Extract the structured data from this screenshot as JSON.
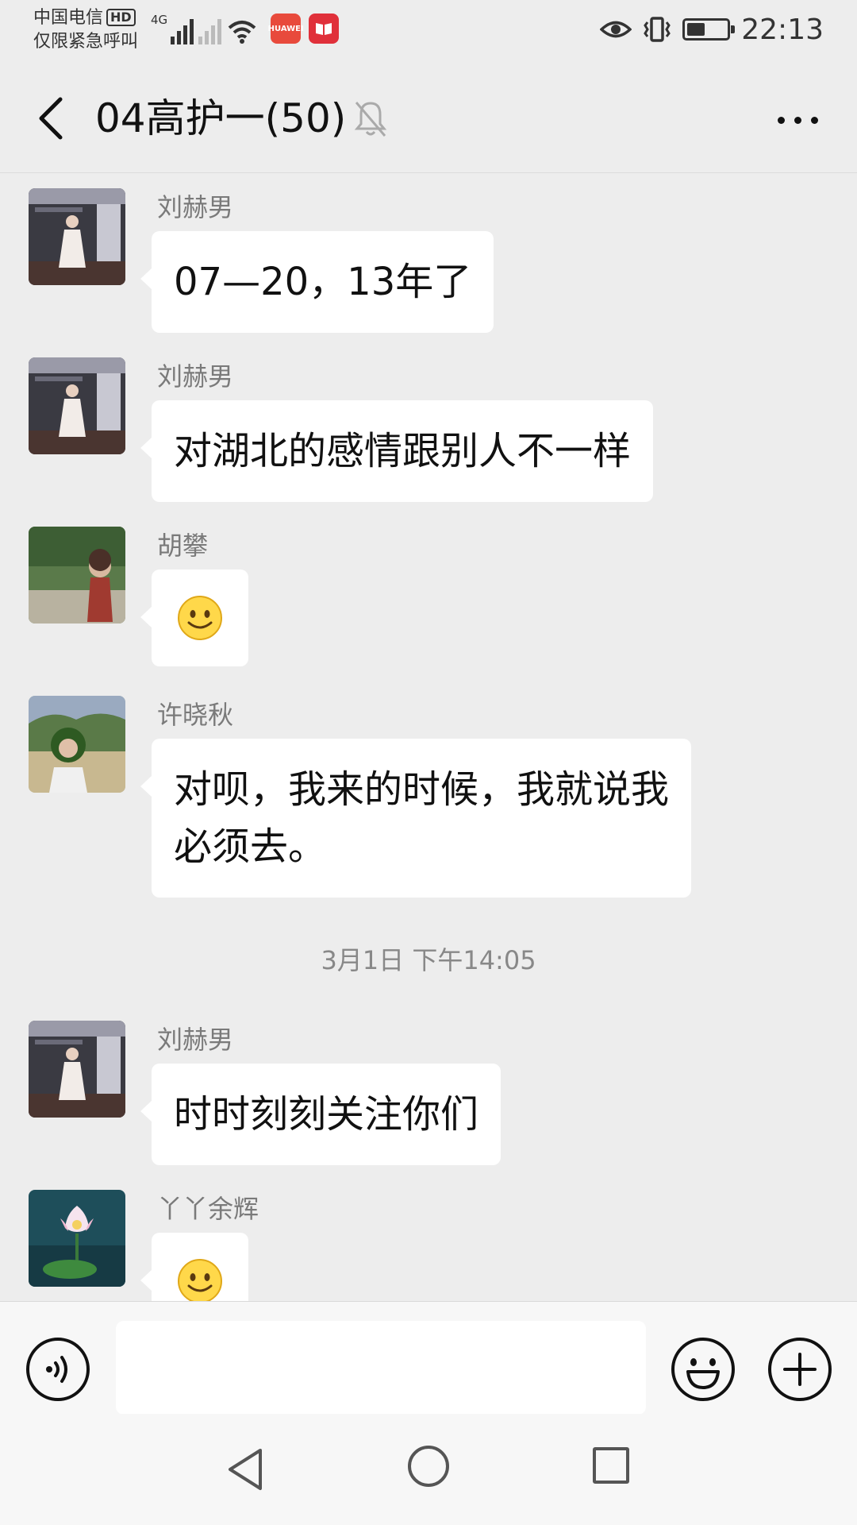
{
  "status_bar": {
    "carrier_line1": "中国电信",
    "hd_badge": "HD",
    "carrier_line2": "仅限紧急呼叫",
    "network": "4G",
    "app_badge1": "HUAWEI",
    "time": "22:13",
    "battery_level": 0.45
  },
  "header": {
    "title": "04高护一(50)"
  },
  "messages": [
    {
      "sender": "刘赫男",
      "text": "07—20，13年了",
      "type": "text"
    },
    {
      "sender": "刘赫男",
      "text": "对湖北的感情跟别人不一样",
      "type": "text"
    },
    {
      "sender": "胡攀",
      "type": "emoji",
      "icon": "smiley-emoji-icon"
    },
    {
      "sender": "许晓秋",
      "line1": "对呗，我来的时候，我就说我",
      "line2": "必须去。",
      "type": "text"
    },
    {
      "sender": "刘赫男",
      "text": "时时刻刻关注你们",
      "type": "text"
    },
    {
      "sender": "丫丫余辉",
      "type": "emoji",
      "icon": "smiley-emoji-icon"
    }
  ],
  "timestamp": "3月1日 下午14:05",
  "input": {
    "value": "",
    "placeholder": ""
  },
  "colors": {
    "background": "#ededed",
    "bubble": "#ffffff",
    "sender_name": "#7a7a7a"
  }
}
